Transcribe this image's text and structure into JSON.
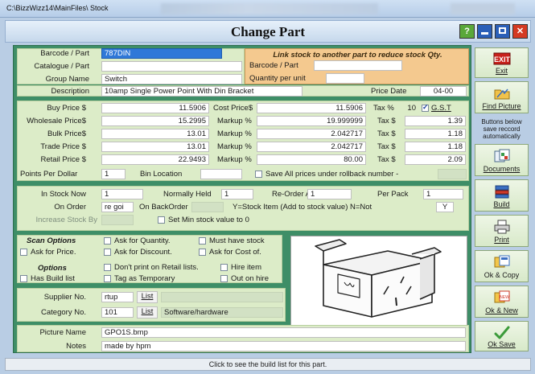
{
  "window": {
    "path": "C:\\BizzWizz14\\MainFiles\\ Stock"
  },
  "header": {
    "title": "Change Part",
    "help": "?"
  },
  "link_panel": {
    "title": "Link stock to another part to reduce stock Qty.",
    "barcode_label": "Barcode / Part",
    "qty_label": "Quantity per unit",
    "barcode_value": "",
    "qty_value": ""
  },
  "labels": {
    "barcode": "Barcode / Part",
    "catalogue": "Catalogue / Part",
    "group": "Group Name",
    "description": "Description",
    "price_date": "Price Date",
    "buy_price": "Buy Price $",
    "wholesale_price": "Wholesale Price$",
    "bulk_price": "Bulk Price$",
    "trade_price": "Trade Price $",
    "retail_price": "Retail Price $",
    "cost_price": "Cost Price$",
    "markup": "Markup %",
    "tax_pct": "Tax %",
    "tax_dollar": "Tax $",
    "gst": "G.S.T",
    "points": "Points Per Dollar",
    "bin": "Bin Location",
    "save_all": "Save All prices under rollback number -",
    "in_stock": "In Stock Now",
    "normally_held": "Normally Held",
    "reorder_at": "Re-Order At",
    "per_pack": "Per Pack",
    "on_order": "On Order",
    "on_backorder": "On BackOrder",
    "stock_item_note": "Y=Stock Item (Add to stock value)  N=Not",
    "increase_by": "Increase Stock By",
    "set_min": "Set Min stock value to 0",
    "scan_options": "Scan Options",
    "ask_qty": "Ask for Quantity.",
    "must_have": "Must have stock",
    "ask_price": "Ask for Price.",
    "ask_discount": "Ask for Discount.",
    "ask_cost": "Ask for Cost of.",
    "options": "Options",
    "dont_print": "Don't print on Retail lists.",
    "hire_item": "Hire item",
    "has_build": "Has Build list",
    "tag_temp": "Tag as Temporary",
    "out_on_hire": "Out on hire",
    "supplier": "Supplier No.",
    "category": "Category No.",
    "list_btn": "List",
    "picture_name": "Picture Name",
    "notes": "Notes"
  },
  "values": {
    "barcode": "787DIN",
    "catalogue": "",
    "group": "Switch",
    "description": "10amp Single Power Point With Din Bracket",
    "price_date": "04-00",
    "buy_price": "11.5906",
    "wholesale_price": "15.2995",
    "bulk_price": "13.01",
    "trade_price": "13.01",
    "retail_price": "22.9493",
    "cost_price": "11.5906",
    "markup_wholesale": "19.999999",
    "markup_bulk": "2.042717",
    "markup_trade": "2.042717",
    "markup_retail": "80.00",
    "tax_pct": "10",
    "tax_wholesale": "1.39",
    "tax_bulk": "1.18",
    "tax_trade": "1.18",
    "tax_retail": "2.09",
    "points": "1",
    "bin": "",
    "rollback": "",
    "in_stock": "1",
    "normally_held": "1",
    "reorder_at": "1",
    "per_pack": "1",
    "on_order": "re goi",
    "on_backorder": "",
    "stock_item": "Y",
    "increase_by": "",
    "supplier": "rtup",
    "supplier_name": "",
    "category": "101",
    "category_name": "Software/hardware",
    "picture_name": "GPO1S.bmp",
    "notes": "made by hpm"
  },
  "sidebar": {
    "exit": "Exit",
    "find_picture": "Find Picture",
    "note": "Buttons below save reccord automatically",
    "documents": "Documents",
    "build": "Build",
    "print": "Print",
    "ok_copy": "Ok & Copy",
    "ok_new": "Ok & New",
    "ok_save": "Ok Save"
  },
  "status": "Click to see the build list for this part.",
  "colors": {
    "form_bg": "#3e8e67",
    "panel_bg": "#dcecc8",
    "link_panel_bg": "#f4c98f",
    "barcode_field": "#2f78d8"
  }
}
